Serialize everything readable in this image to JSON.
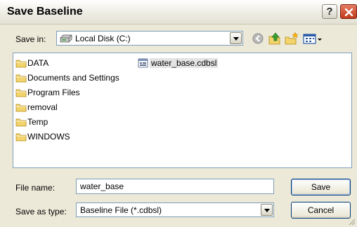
{
  "window": {
    "title": "Save Baseline",
    "help_glyph": "?"
  },
  "save_in": {
    "label": "Save in:",
    "value": "Local Disk (C:)"
  },
  "toolbar": {
    "icons": [
      "back-icon",
      "up-folder-icon",
      "new-folder-icon",
      "views-menu-icon"
    ]
  },
  "files": {
    "column1": [
      {
        "name": "DATA",
        "type": "folder"
      },
      {
        "name": "Documents and Settings",
        "type": "folder"
      },
      {
        "name": "Program Files",
        "type": "folder"
      },
      {
        "name": "removal",
        "type": "folder"
      },
      {
        "name": "Temp",
        "type": "folder"
      },
      {
        "name": "WINDOWS",
        "type": "folder"
      }
    ],
    "column2": [
      {
        "name": "water_base.cdbsl",
        "type": "file",
        "selected": true
      }
    ]
  },
  "file_name": {
    "label": "File name:",
    "value": "water_base"
  },
  "save_as_type": {
    "label": "Save as type:",
    "value": "Baseline File (*.cdbsl)"
  },
  "buttons": {
    "save": "Save",
    "cancel": "Cancel"
  },
  "colors": {
    "selection": "#e3e3e3",
    "folder": "#f3d36b",
    "field_border": "#7f9db9",
    "dialog_bg": "#ece9d8"
  }
}
